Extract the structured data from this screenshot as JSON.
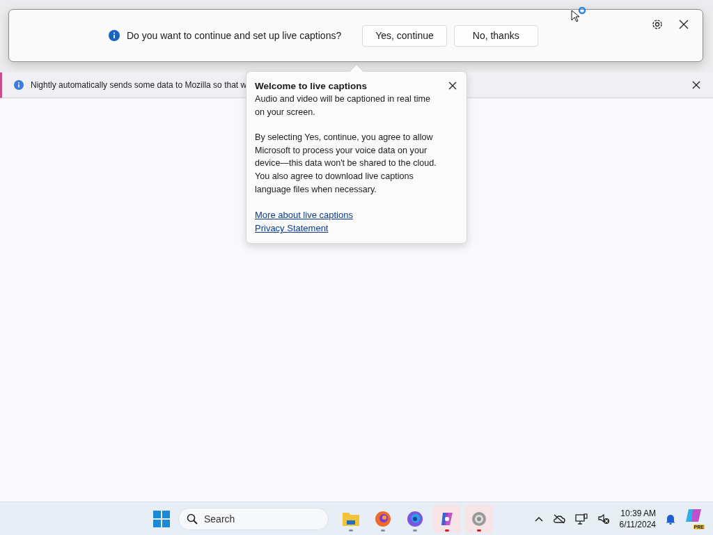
{
  "browser": {
    "notification": {
      "text": "Nightly automatically sends some data to Mozilla so that w"
    }
  },
  "caption_prompt": {
    "message": "Do you want to continue and set up live captions?",
    "buttons": [
      "Yes, continue",
      "No, thanks"
    ]
  },
  "popup": {
    "title": "Welcome to live captions",
    "paragraphs": [
      "Audio and video will be captioned in real time on your screen.",
      "By selecting Yes, continue, you agree to allow Microsoft to process your voice data on your device—this data won't be shared to the cloud. You also agree to download live captions language files when necessary."
    ],
    "links": [
      "More about live captions",
      "Privacy Statement"
    ]
  },
  "taskbar": {
    "search": {
      "placeholder": "Search"
    },
    "apps": [
      {
        "kind": "folder",
        "active": false
      },
      {
        "kind": "firefox",
        "active": false
      },
      {
        "kind": "nightly",
        "active": false
      },
      {
        "kind": "copilot",
        "active": true
      },
      {
        "kind": "settings",
        "active": true
      }
    ],
    "tray": {
      "time": "10:39 AM",
      "date": "6/11/2024",
      "badge": "PRE"
    }
  }
}
